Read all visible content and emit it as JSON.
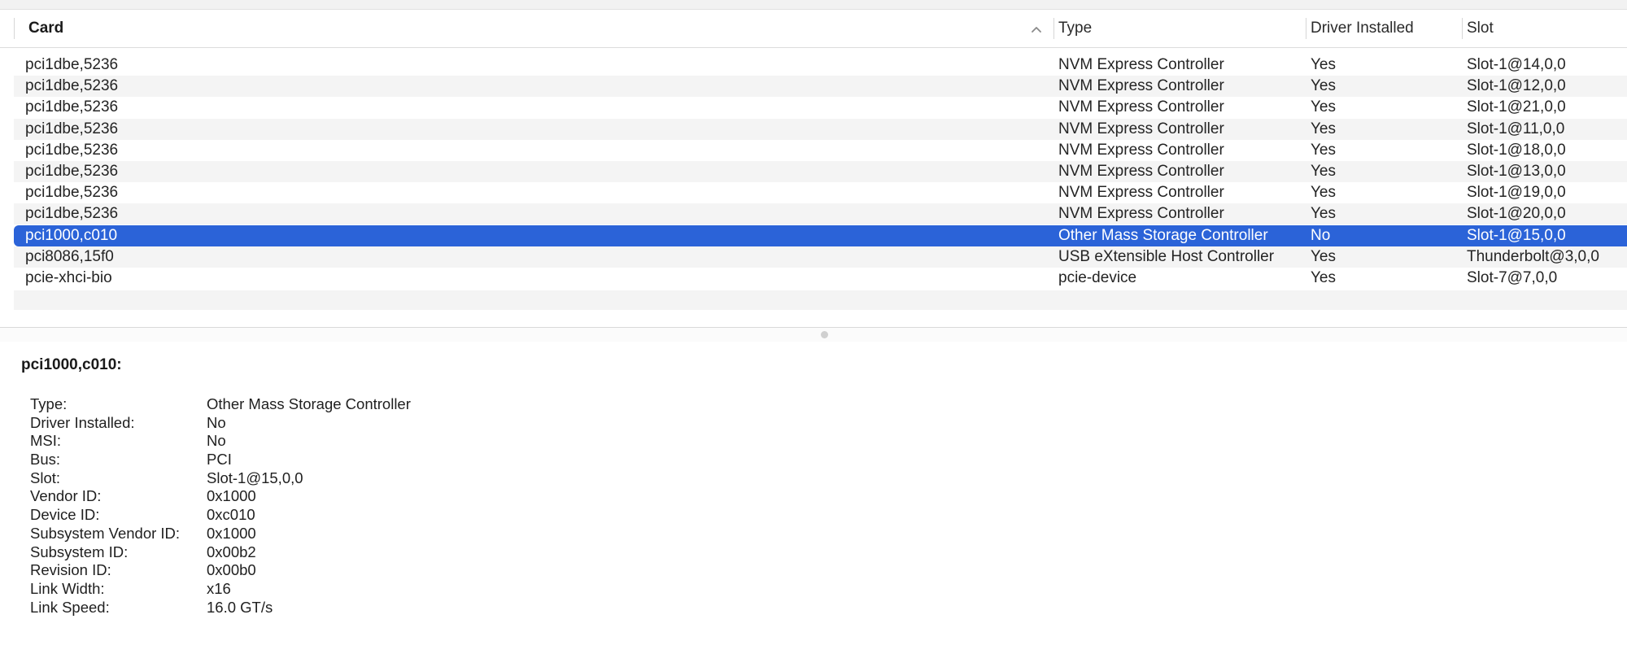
{
  "table": {
    "columns": {
      "card": "Card",
      "type": "Type",
      "driver": "Driver Installed",
      "slot": "Slot"
    },
    "sort_icon": "chevron-up-icon",
    "rows": [
      {
        "card": "pci1dbe,5236",
        "type": "NVM Express Controller",
        "driver": "Yes",
        "slot": "Slot-1@14,0,0"
      },
      {
        "card": "pci1dbe,5236",
        "type": "NVM Express Controller",
        "driver": "Yes",
        "slot": "Slot-1@12,0,0"
      },
      {
        "card": "pci1dbe,5236",
        "type": "NVM Express Controller",
        "driver": "Yes",
        "slot": "Slot-1@21,0,0"
      },
      {
        "card": "pci1dbe,5236",
        "type": "NVM Express Controller",
        "driver": "Yes",
        "slot": "Slot-1@11,0,0"
      },
      {
        "card": "pci1dbe,5236",
        "type": "NVM Express Controller",
        "driver": "Yes",
        "slot": "Slot-1@18,0,0"
      },
      {
        "card": "pci1dbe,5236",
        "type": "NVM Express Controller",
        "driver": "Yes",
        "slot": "Slot-1@13,0,0"
      },
      {
        "card": "pci1dbe,5236",
        "type": "NVM Express Controller",
        "driver": "Yes",
        "slot": "Slot-1@19,0,0"
      },
      {
        "card": "pci1dbe,5236",
        "type": "NVM Express Controller",
        "driver": "Yes",
        "slot": "Slot-1@20,0,0"
      },
      {
        "card": "pci1000,c010",
        "type": "Other Mass Storage Controller",
        "driver": "No",
        "slot": "Slot-1@15,0,0"
      },
      {
        "card": "pci8086,15f0",
        "type": "USB eXtensible Host Controller",
        "driver": "Yes",
        "slot": "Thunderbolt@3,0,0"
      },
      {
        "card": "pcie-xhci-bio",
        "type": "pcie-device",
        "driver": "Yes",
        "slot": "Slot-7@7,0,0"
      }
    ],
    "selected_row": 8,
    "selection_color": "#2b63d8"
  },
  "detail": {
    "title": "pci1000,c010:",
    "fields": [
      {
        "key": "Type:",
        "value": "Other Mass Storage Controller"
      },
      {
        "key": "Driver Installed:",
        "value": "No"
      },
      {
        "key": "MSI:",
        "value": "No"
      },
      {
        "key": "Bus:",
        "value": "PCI"
      },
      {
        "key": "Slot:",
        "value": "Slot-1@15,0,0"
      },
      {
        "key": "Vendor ID:",
        "value": "0x1000"
      },
      {
        "key": "Device ID:",
        "value": "0xc010"
      },
      {
        "key": "Subsystem Vendor ID:",
        "value": "0x1000"
      },
      {
        "key": "Subsystem ID:",
        "value": "0x00b2"
      },
      {
        "key": "Revision ID:",
        "value": "0x00b0"
      },
      {
        "key": "Link Width:",
        "value": "x16"
      },
      {
        "key": "Link Speed:",
        "value": "16.0 GT/s"
      }
    ]
  }
}
